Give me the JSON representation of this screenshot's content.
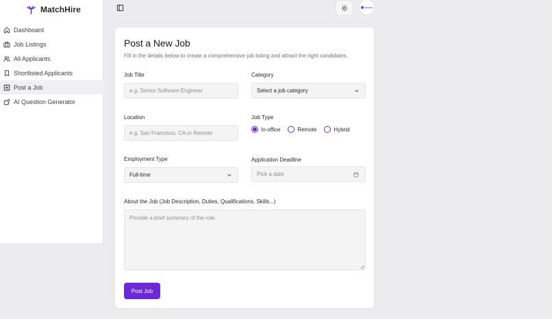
{
  "brand": {
    "name": "MatchHire",
    "icon": "branch-icon",
    "color": "#6d28d9"
  },
  "sidebar": {
    "items": [
      {
        "label": "Dashboard",
        "icon": "home-icon"
      },
      {
        "label": "Job Listings",
        "icon": "briefcase-icon"
      },
      {
        "label": "All Applicants",
        "icon": "users-icon"
      },
      {
        "label": "Shortlisted Applicants",
        "icon": "bookmark-icon"
      },
      {
        "label": "Post a Job",
        "icon": "plus-square-icon",
        "active": true
      },
      {
        "label": "AI Question Generator",
        "icon": "puzzle-icon"
      }
    ]
  },
  "topbar": {
    "toggle_icon": "sidebar-toggle-icon",
    "theme_icon": "sun-icon"
  },
  "form": {
    "title": "Post a New Job",
    "subtitle": "Fill in the details below to create a comprehensive job listing and attract the right candidates.",
    "job_title": {
      "label": "Job Title",
      "placeholder": "e.g. Senior Software Engineer"
    },
    "category": {
      "label": "Category",
      "value": "Select a job category"
    },
    "location": {
      "label": "Location",
      "placeholder": "e.g. San Francisco, CA or Remote"
    },
    "job_type": {
      "label": "Job Type",
      "options": [
        "In-office",
        "Remote",
        "Hybrid"
      ],
      "selected": "In-office"
    },
    "employment_type": {
      "label": "Employment Type",
      "value": "Full-time"
    },
    "deadline": {
      "label": "Application Deadline",
      "placeholder": "Pick a date"
    },
    "about": {
      "label": "About the Job (Job Description, Duties, Qualifications, Skills...)",
      "placeholder": "Provide a brief summary of the role."
    },
    "submit_label": "Post Job"
  },
  "colors": {
    "accent": "#6d28d9",
    "background": "#ececee",
    "card": "#ffffff"
  }
}
